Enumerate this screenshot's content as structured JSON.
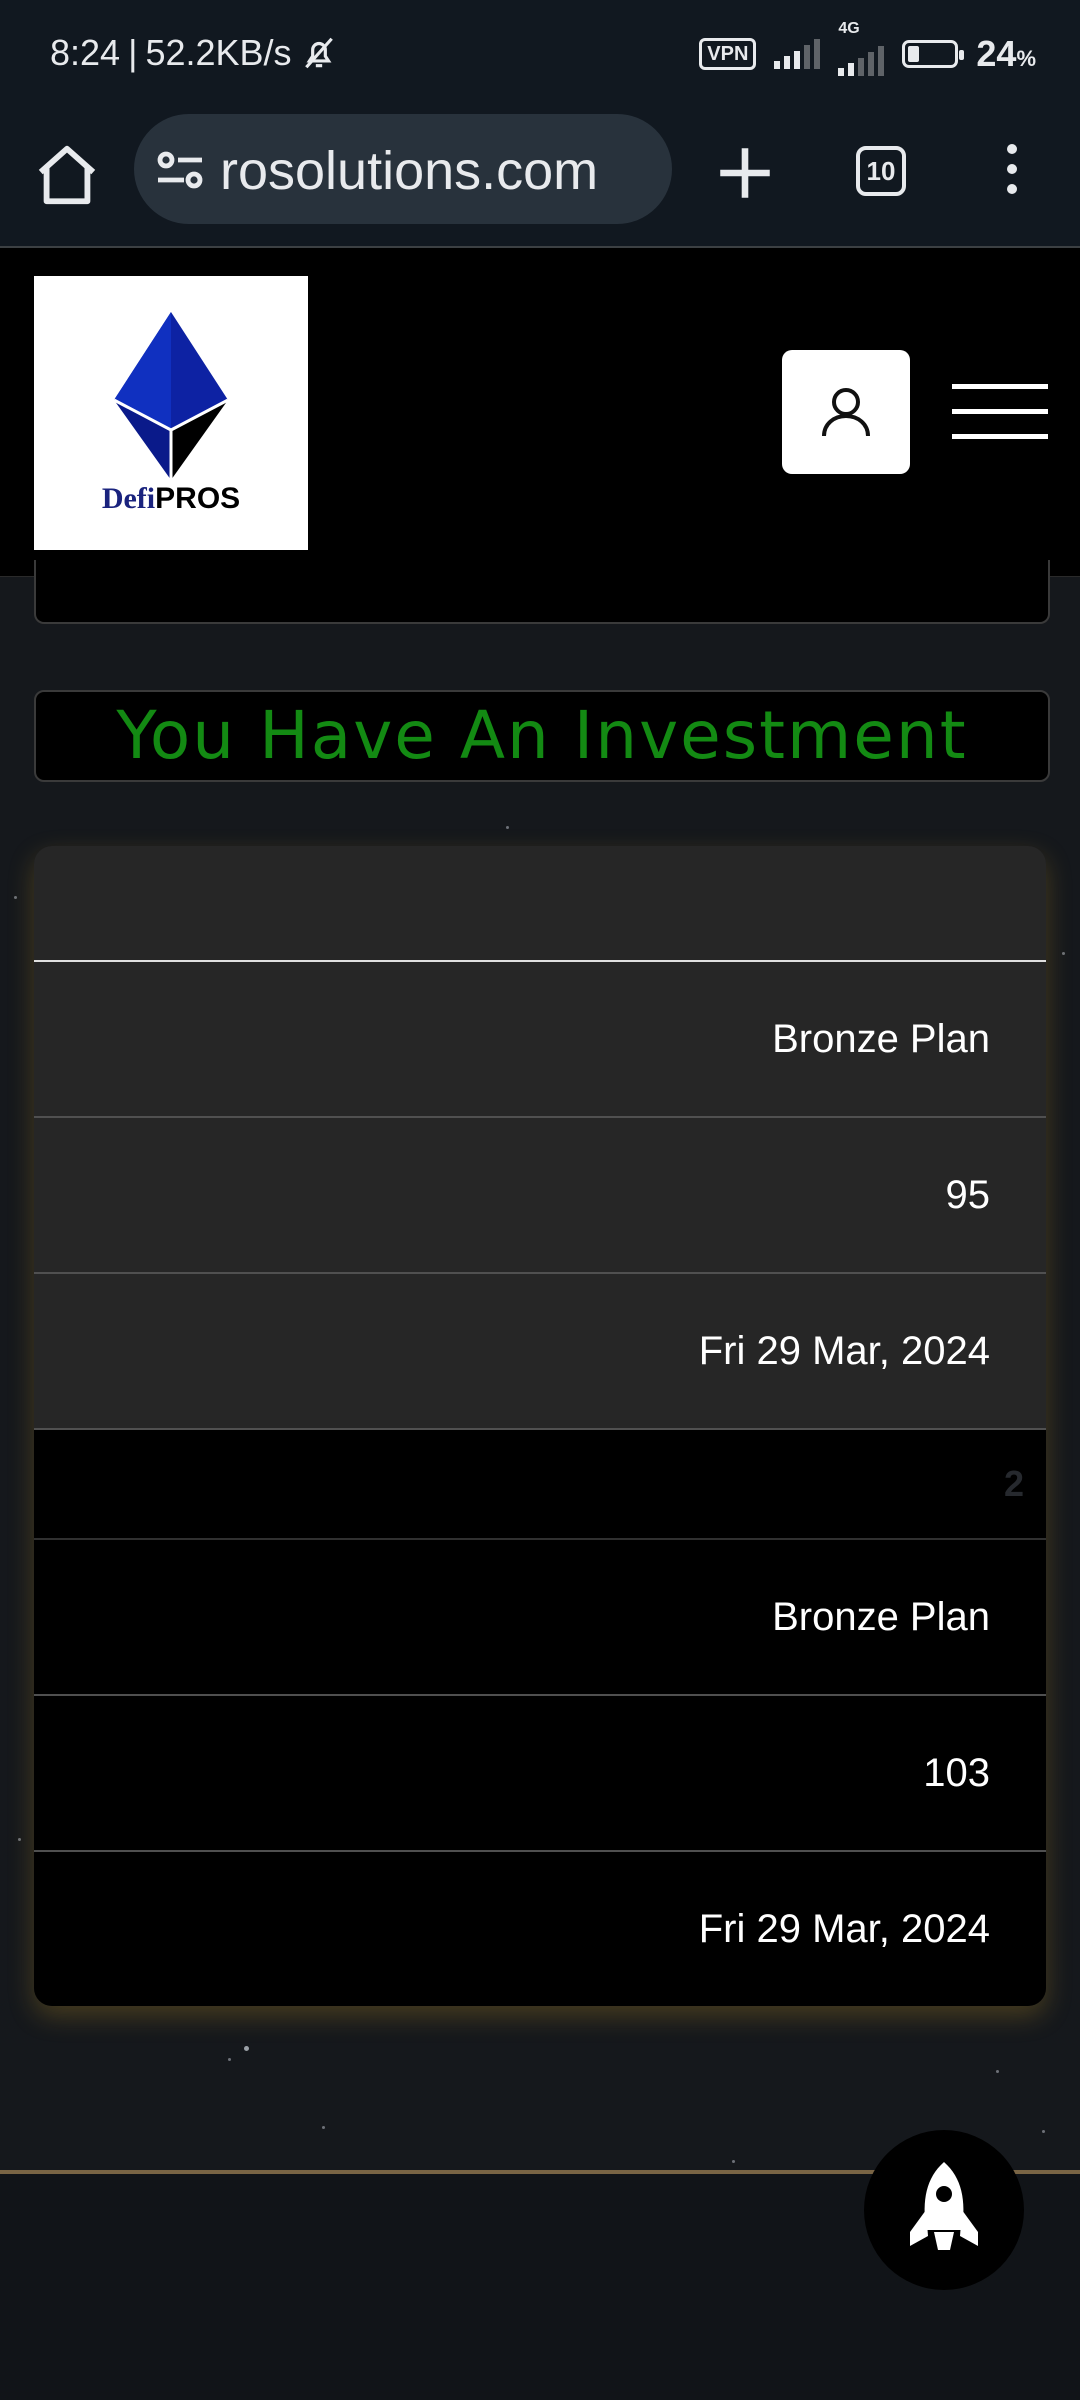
{
  "status_bar": {
    "time": "8:24",
    "speed": "52.2KB/s",
    "vpn": "VPN",
    "network": "4G",
    "battery_level": 24,
    "battery": "24",
    "battery_unit": "%"
  },
  "browser": {
    "url": "rosolutions.com",
    "tab_count": "10"
  },
  "site": {
    "logo_defi": "Defi",
    "logo_pros": "PROS"
  },
  "content": {
    "title": "You Have An Investment",
    "title_color": "#138a13",
    "investments": [
      {
        "index": "",
        "plan": "Bronze Plan",
        "amount": "95",
        "date": "Fri 29 Mar, 2024"
      },
      {
        "index": "2",
        "plan": "Bronze Plan",
        "amount": "103",
        "date": "Fri 29 Mar, 2024"
      }
    ]
  }
}
